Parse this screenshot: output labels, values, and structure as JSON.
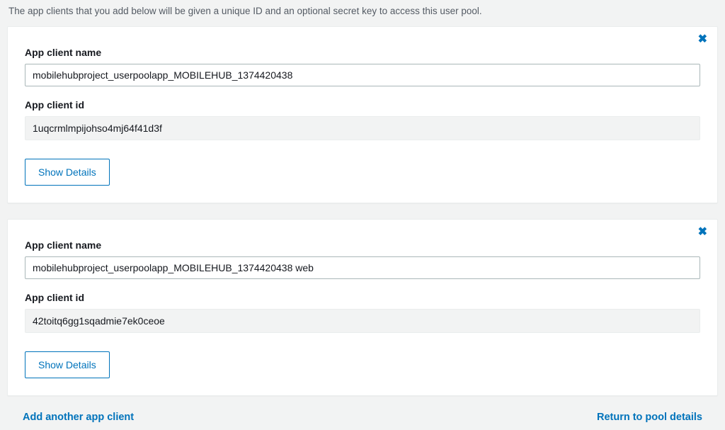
{
  "page": {
    "description": "The app clients that you add below will be given a unique ID and an optional secret key to access this user pool."
  },
  "labels": {
    "app_client_name": "App client name",
    "app_client_id": "App client id",
    "show_details": "Show Details"
  },
  "clients": {
    "0": {
      "name": "mobilehubproject_userpoolapp_MOBILEHUB_1374420438",
      "id": "1uqcrmlmpijohso4mj64f41d3f"
    },
    "1": {
      "name": "mobilehubproject_userpoolapp_MOBILEHUB_1374420438 web",
      "id": "42toitq6gg1sqadmie7ek0ceoe"
    }
  },
  "footer": {
    "add_link": "Add another app client",
    "return_link": "Return to pool details"
  },
  "icons": {
    "close": "✖"
  }
}
